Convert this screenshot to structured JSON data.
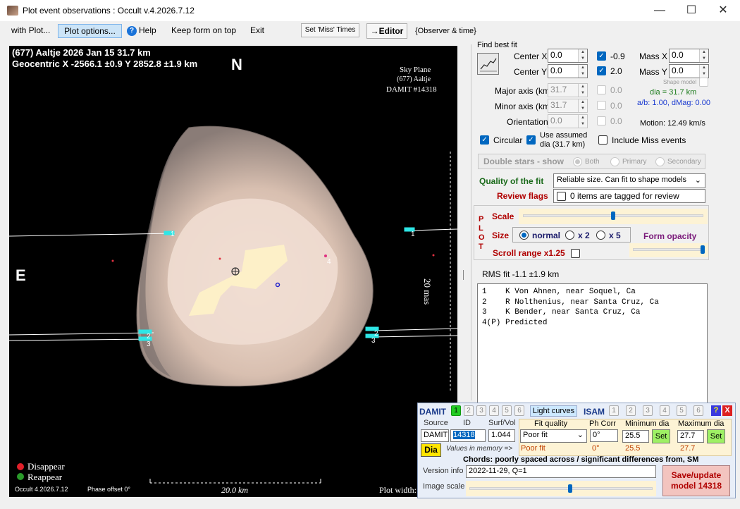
{
  "window": {
    "title": "Plot event observations : Occult v.4.2026.7.12",
    "minimize": "—",
    "maximize": "☐",
    "close": "✕"
  },
  "menubar": {
    "with_plot": "with Plot...",
    "plot_options": "Plot options...",
    "help": "Help",
    "keep_on_top": "Keep form on top",
    "exit": "Exit",
    "set_miss_times": "Set 'Miss' Times",
    "editor": "→Editor",
    "observer_time": "{Observer & time}"
  },
  "plot": {
    "header_line1": "(677) Aaltje  2026 Jan 15   31.7 km",
    "header_line2": "Geocentric  X  -2566.1 ±0.9  Y  2852.8 ±1.9 km",
    "north": "N",
    "east": "E",
    "sky_plane": "Sky Plane",
    "asteroid": "(677) Aaltje",
    "damit_id": "DAMIT #14318",
    "scale_label": "20 mas",
    "km_scale": "20.0 km",
    "legend_disappear": "Disappear",
    "legend_reappear": "Reappear",
    "footer_version": "Occult 4.2026.7.12",
    "phase_offset": "Phase offset 0°",
    "plot_width": "Plot width:",
    "chord_labels": [
      "1",
      "2",
      "3",
      "1",
      "2",
      "3",
      "4"
    ],
    "colors": {
      "disappear": "#e0202a",
      "reappear": "#2a9a2a",
      "chord": "#ffffff",
      "marker": "#2ee6e6"
    }
  },
  "fit": {
    "group": "Find best fit",
    "center_x_label": "Center X",
    "center_x": "0.0",
    "center_y_label": "Center Y",
    "center_y": "0.0",
    "chk_x_val": "-0.9",
    "chk_y_val": "2.0",
    "mass_x_label": "Mass X",
    "mass_x": "0.0",
    "mass_y_label": "Mass Y",
    "mass_y": "0.0",
    "shape_model": "Shape model",
    "major_label": "Major axis (km)",
    "major": "31.7",
    "major_chk": "0.0",
    "minor_label": "Minor axis (km)",
    "minor": "31.7",
    "minor_chk": "0.0",
    "orient_label": "Orientation",
    "orient": "0.0",
    "orient_chk": "0.0",
    "dia_text": "dia = 31.7 km",
    "ab_text": "a/b: 1.00, dMag: 0.00",
    "motion": "Motion: 12.49 km/s",
    "circular": "Circular",
    "use_assumed": "Use assumed",
    "use_assumed2": "dia (31.7 km)",
    "include_miss": "Include Miss events"
  },
  "double_stars": {
    "label": "Double stars - show",
    "both": "Both",
    "primary": "Primary",
    "secondary": "Secondary"
  },
  "quality": {
    "label": "Quality of the fit",
    "value": "Reliable size. Can fit to shape models"
  },
  "review": {
    "label": "Review flags",
    "text": "0 items are tagged for review"
  },
  "plotctl": {
    "vertical": [
      "P",
      "L",
      "O",
      "T"
    ],
    "scale": "Scale",
    "size": "Size",
    "normal": "normal",
    "x2": "x 2",
    "x5": "x 5",
    "form_opacity": "Form opacity",
    "scroll_range": "Scroll range x1.25",
    "scale_level": 0.5,
    "opacity_level": 0.97
  },
  "rms": "RMS fit -1.1 ±1.9 km",
  "chords": [
    "1    K Von Ahnen, near Soquel, Ca",
    "2    R Nolthenius, near Santa Cruz, Ca",
    "3    K Bender, near Santa Cruz, Ca",
    "4(P) Predicted"
  ],
  "damit": {
    "title": "DAMIT",
    "numbers": [
      "1",
      "2",
      "3",
      "4",
      "5",
      "6"
    ],
    "light_curves": "Light curves",
    "isam": "ISAM",
    "help": "?",
    "close": "X",
    "source_label": "Source",
    "id_label": "ID",
    "surf_label": "Surf/Vol",
    "source": "DAMIT",
    "id": "14318",
    "surf": "1.044",
    "dia_btn": "Dia",
    "values_in_memory": "Values in memory =>",
    "fit_quality_label": "Fit quality",
    "fit_quality": "Poor fit",
    "fit_quality_mem": "Poor fit",
    "ph_corr_label": "Ph Corr",
    "ph_corr": "0°",
    "ph_corr_mem": "0°",
    "min_dia_label": "Minimum dia",
    "min_dia": "25.5",
    "min_dia_mem": "25.5",
    "max_dia_label": "Maximum dia",
    "max_dia": "27.7",
    "max_dia_mem": "27.7",
    "set": "Set",
    "chords_note": "Chords: poorly spaced across / significant differences from, SM",
    "version_label": "Version info",
    "version": "2022-11-29, Q=1",
    "image_scale_label": "Image scale",
    "image_scale_level": 0.55,
    "save_update": "Save/update",
    "save_update2": "model 14318"
  }
}
